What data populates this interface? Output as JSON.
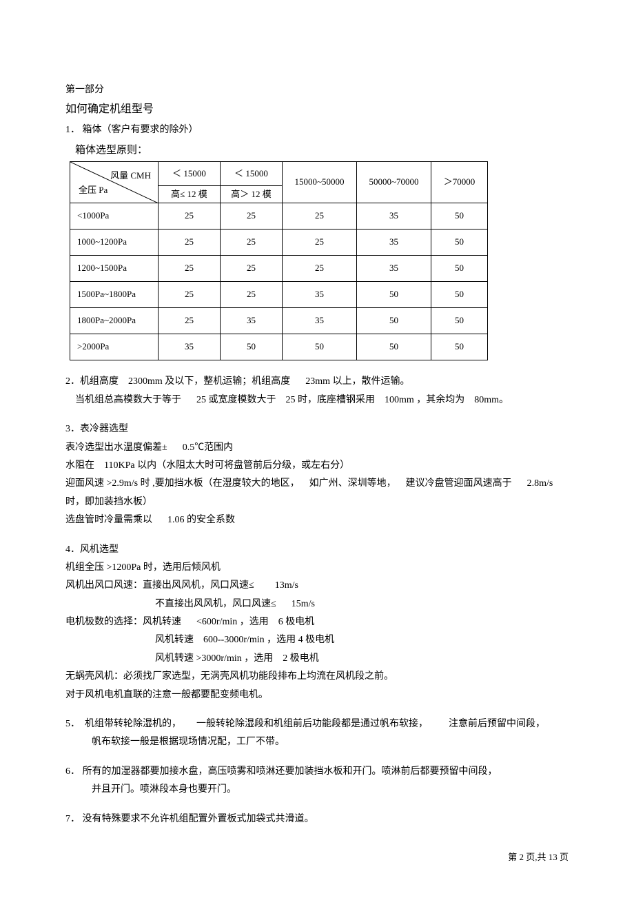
{
  "header": {
    "part_label": "第一部分",
    "title": "如何确定机组型号"
  },
  "section1": {
    "head": "1．  箱体（客户有要求的除外）",
    "principle": "箱体选型原则：",
    "table": {
      "diag_top": "风量  CMH",
      "diag_bot": "全压  Pa",
      "cols_top": [
        "＜ 15000",
        "＜ 15000",
        "15000~50000",
        "50000~70000",
        "＞70000"
      ],
      "cols_sub": [
        "高≤ 12 模",
        "高＞ 12 模"
      ],
      "rows": [
        {
          "label": "<1000Pa",
          "v": [
            "25",
            "25",
            "25",
            "35",
            "50"
          ]
        },
        {
          "label": "1000~1200Pa",
          "v": [
            "25",
            "25",
            "25",
            "35",
            "50"
          ]
        },
        {
          "label": "1200~1500Pa",
          "v": [
            "25",
            "25",
            "25",
            "35",
            "50"
          ]
        },
        {
          "label": "1500Pa~1800Pa",
          "v": [
            "25",
            "25",
            "35",
            "50",
            "50"
          ]
        },
        {
          "label": "1800Pa~2000Pa",
          "v": [
            "25",
            "35",
            "35",
            "50",
            "50"
          ]
        },
        {
          "label": ">2000Pa",
          "v": [
            "35",
            "50",
            "50",
            "50",
            "50"
          ]
        }
      ]
    }
  },
  "section2": {
    "l1a": "2．机组高度",
    "l1b": "2300mm 及以下，整机运输；机组高度",
    "l1c": "23mm 以上，散件运输。",
    "l2a": "当机组总高模数大于等于",
    "l2b": "25 或宽度模数大于",
    "l2c": "25 时，底座槽钢采用",
    "l2d": "100mm ，其余均为",
    "l2e": "80mm。"
  },
  "section3": {
    "head": "3．表冷器选型",
    "l1a": "表冷选型出水温度偏差±",
    "l1b": "0.5℃范围内",
    "l2a": "水阻在",
    "l2b": "110KPa 以内（水阻太大时可将盘管前后分级，或左右分）",
    "l3a": "迎面风速",
    "l3b": ">2.9m/s 时 ,要加挡水板（在湿度较大的地区，",
    "l3c": "如广州、深圳等地，",
    "l3d": "建议冷盘管迎面风速高于",
    "l3e": "2.8m/s",
    "l4": "时，即加装挡水板）",
    "l5a": "选盘管时冷量需乘以",
    "l5b": "1.06 的安全系数"
  },
  "section4": {
    "head": "4．风机选型",
    "l1a": "机组全压",
    "l1b": ">1200Pa 时，选用后倾风机",
    "l2a": "风机出风口风速：直接出风风机，风口风速≤",
    "l2b": "13m/s",
    "l3a": "不直接出风风机，风口风速≤",
    "l3b": "15m/s",
    "l4a": "电机极数的选择：风机转速",
    "l4b": "<600r/min ，选用",
    "l4c": "6 极电机",
    "l5a": "风机转速",
    "l5b": "600--3000r/min  ，选用",
    "l5c": "4 极电机",
    "l6a": "风机转速",
    "l6b": ">3000r/min ，选用",
    "l6c": "2 极电机",
    "l7": "无蜗壳风机：必须找厂家选型，无涡壳风机功能段排布上均流在风机段之前。",
    "l8": "对于风机电机直联的注意一般都要配变频电机。"
  },
  "section5": {
    "l1a": "5．",
    "l1b": "机组带转轮除湿机的，",
    "l1c": "一般转轮除湿段和机组前后功能段都是通过帆布软接，",
    "l1d": "注意前后预留中间段，",
    "l2": "帆布软接一般是根据现场情况配，工厂不带。"
  },
  "section6": {
    "l1": "6．  所有的加湿器都要加接水盘，高压喷雾和喷淋还要加装挡水板和开门。喷淋前后都要预留中间段，",
    "l2": "并且开门。喷淋段本身也要开门。"
  },
  "section7": {
    "l1": "7．  没有特殊要求不允许机组配置外置板式加袋式共滑道。"
  },
  "footer": {
    "text": "第 2 页,共 13 页"
  }
}
